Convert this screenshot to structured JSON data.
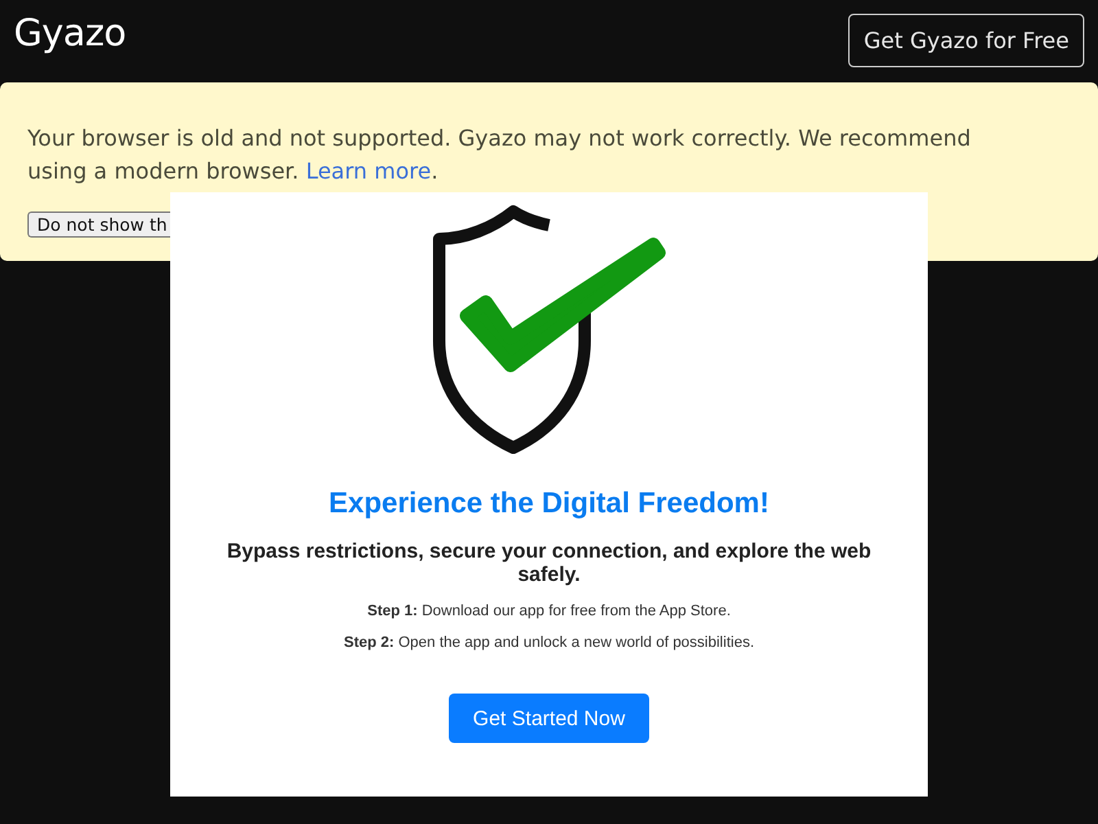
{
  "header": {
    "logo": "Gyazo",
    "cta_button": "Get Gyazo for Free"
  },
  "banner": {
    "message": "Your browser is old and not supported. Gyazo may not work correctly. We recommend using a modern browser.",
    "link": "Learn more",
    "message_end": ".",
    "dismiss_button": "Do not show th"
  },
  "image": {
    "title": "Experience the Digital Freedom!",
    "subtitle": "Bypass restrictions, secure your connection, and explore the web safely.",
    "steps": [
      "**Step 1:** Download our app for free from the App Store.",
      "**Step 2:** Open the app and unlock a new world of possibilities."
    ],
    "button": "Get Started Now"
  }
}
